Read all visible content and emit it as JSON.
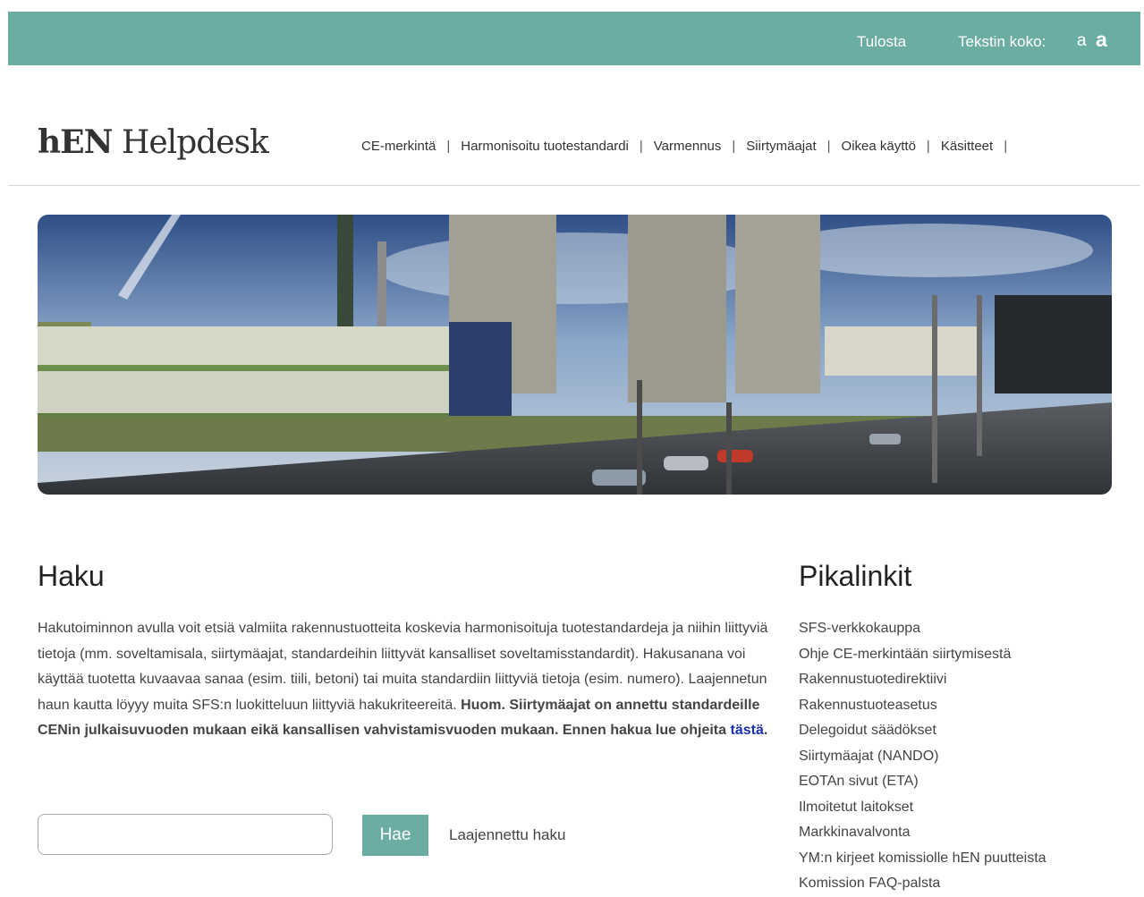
{
  "topbar": {
    "print": "Tulosta",
    "text_size_label": "Tekstin koko:",
    "a_small": "a",
    "a_large": "a"
  },
  "logo": {
    "bold": "hEN",
    "rest": " Helpdesk"
  },
  "nav": [
    "CE-merkintä",
    "Harmonisoitu tuotestandardi",
    "Varmennus",
    "Siirtymäajat",
    "Oikea käyttö",
    "Käsitteet"
  ],
  "search": {
    "heading": "Haku",
    "intro_text": "Hakutoiminnon avulla voit etsiä valmiita rakennustuotteita koskevia harmonisoituja tuotestandardeja ja niihin liittyviä tietoja (mm. soveltamisala, siirtymäajat, standardeihin liittyvät kansalliset soveltamisstandardit). Hakusanana voi käyttää tuotetta kuvaavaa sanaa (esim. tiili, betoni) tai muita standardiin liittyviä tietoja (esim. numero). Laajennetun haun kautta löyyy muita SFS:n luokitteluun liittyviä hakukriteereitä. ",
    "intro_bold": "Huom. Siirtymäajat on annettu standardeille CENin julkaisuvuoden mukaan eikä kansallisen vahvistamisvuoden mukaan. Ennen hakua lue ohjeita ",
    "intro_link": "tästä",
    "intro_end": ".",
    "input_value": "",
    "button": "Hae",
    "advanced": "Laajennettu haku"
  },
  "quicklinks": {
    "heading": "Pikalinkit",
    "items": [
      "SFS-verkkokauppa",
      "Ohje CE-merkintään siirtymisestä",
      "Rakennustuotedirektiivi",
      "Rakennustuoteasetus",
      "Delegoidut säädökset",
      "Siirtymäajat (NANDO)",
      "EOTAn sivut (ETA)",
      "Ilmoitetut laitokset",
      "Markkinavalvonta",
      "YM:n kirjeet komissiolle hEN puutteista",
      "Komission FAQ-palsta"
    ]
  },
  "colors": {
    "accent": "#6cada3",
    "link": "#1a2fb3"
  }
}
